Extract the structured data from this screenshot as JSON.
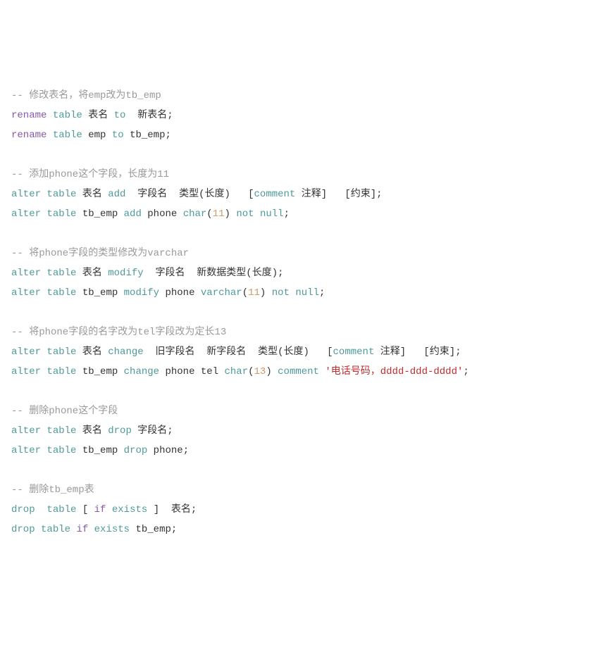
{
  "lines": [
    {
      "type": "comment",
      "text": "-- 修改表名，将emp改为tb_emp"
    },
    {
      "type": "code",
      "tokens": [
        {
          "t": "rename",
          "c": "keyword-purple"
        },
        {
          "t": " ",
          "c": "punct"
        },
        {
          "t": "table",
          "c": "keyword"
        },
        {
          "t": " 表名 ",
          "c": "identifier"
        },
        {
          "t": "to",
          "c": "keyword"
        },
        {
          "t": "  新表名",
          "c": "identifier"
        },
        {
          "t": ";",
          "c": "punct"
        }
      ]
    },
    {
      "type": "code",
      "tokens": [
        {
          "t": "rename",
          "c": "keyword-purple"
        },
        {
          "t": " ",
          "c": "punct"
        },
        {
          "t": "table",
          "c": "keyword"
        },
        {
          "t": " emp ",
          "c": "identifier"
        },
        {
          "t": "to",
          "c": "keyword"
        },
        {
          "t": " tb_emp",
          "c": "identifier"
        },
        {
          "t": ";",
          "c": "punct"
        }
      ]
    },
    {
      "type": "blank"
    },
    {
      "type": "comment",
      "text": "-- 添加phone这个字段，长度为11"
    },
    {
      "type": "code",
      "tokens": [
        {
          "t": "alter",
          "c": "keyword"
        },
        {
          "t": " ",
          "c": "punct"
        },
        {
          "t": "table",
          "c": "keyword"
        },
        {
          "t": " 表名 ",
          "c": "identifier"
        },
        {
          "t": "add",
          "c": "keyword"
        },
        {
          "t": "  字段名  类型",
          "c": "identifier"
        },
        {
          "t": "(",
          "c": "paren"
        },
        {
          "t": "长度",
          "c": "identifier"
        },
        {
          "t": ")",
          "c": "paren"
        },
        {
          "t": "   ",
          "c": "punct"
        },
        {
          "t": "[",
          "c": "bracket"
        },
        {
          "t": "comment",
          "c": "keyword"
        },
        {
          "t": " 注释",
          "c": "identifier"
        },
        {
          "t": "]",
          "c": "bracket"
        },
        {
          "t": "   ",
          "c": "punct"
        },
        {
          "t": "[",
          "c": "bracket"
        },
        {
          "t": "约束",
          "c": "identifier"
        },
        {
          "t": "]",
          "c": "bracket"
        },
        {
          "t": ";",
          "c": "punct"
        }
      ]
    },
    {
      "type": "code",
      "tokens": [
        {
          "t": "alter",
          "c": "keyword"
        },
        {
          "t": " ",
          "c": "punct"
        },
        {
          "t": "table",
          "c": "keyword"
        },
        {
          "t": " tb_emp ",
          "c": "identifier"
        },
        {
          "t": "add",
          "c": "keyword"
        },
        {
          "t": " phone ",
          "c": "identifier"
        },
        {
          "t": "char",
          "c": "keyword"
        },
        {
          "t": "(",
          "c": "paren"
        },
        {
          "t": "11",
          "c": "number"
        },
        {
          "t": ")",
          "c": "paren"
        },
        {
          "t": " ",
          "c": "punct"
        },
        {
          "t": "not",
          "c": "keyword"
        },
        {
          "t": " ",
          "c": "punct"
        },
        {
          "t": "null",
          "c": "keyword"
        },
        {
          "t": ";",
          "c": "punct"
        }
      ]
    },
    {
      "type": "blank"
    },
    {
      "type": "comment",
      "text": "-- 将phone字段的类型修改为varchar"
    },
    {
      "type": "code",
      "tokens": [
        {
          "t": "alter",
          "c": "keyword"
        },
        {
          "t": " ",
          "c": "punct"
        },
        {
          "t": "table",
          "c": "keyword"
        },
        {
          "t": " 表名 ",
          "c": "identifier"
        },
        {
          "t": "modify",
          "c": "keyword"
        },
        {
          "t": "  字段名  新数据类型",
          "c": "identifier"
        },
        {
          "t": "(",
          "c": "paren"
        },
        {
          "t": "长度",
          "c": "identifier"
        },
        {
          "t": ")",
          "c": "paren"
        },
        {
          "t": ";",
          "c": "punct"
        }
      ]
    },
    {
      "type": "code",
      "tokens": [
        {
          "t": "alter",
          "c": "keyword"
        },
        {
          "t": " ",
          "c": "punct"
        },
        {
          "t": "table",
          "c": "keyword"
        },
        {
          "t": " tb_emp ",
          "c": "identifier"
        },
        {
          "t": "modify",
          "c": "keyword"
        },
        {
          "t": " phone ",
          "c": "identifier"
        },
        {
          "t": "varchar",
          "c": "keyword"
        },
        {
          "t": "(",
          "c": "paren"
        },
        {
          "t": "11",
          "c": "number"
        },
        {
          "t": ")",
          "c": "paren"
        },
        {
          "t": " ",
          "c": "punct"
        },
        {
          "t": "not",
          "c": "keyword"
        },
        {
          "t": " ",
          "c": "punct"
        },
        {
          "t": "null",
          "c": "keyword"
        },
        {
          "t": ";",
          "c": "punct"
        }
      ]
    },
    {
      "type": "blank"
    },
    {
      "type": "comment",
      "text": "-- 将phone字段的名字改为tel字段改为定长13"
    },
    {
      "type": "code",
      "tokens": [
        {
          "t": "alter",
          "c": "keyword"
        },
        {
          "t": " ",
          "c": "punct"
        },
        {
          "t": "table",
          "c": "keyword"
        },
        {
          "t": " 表名 ",
          "c": "identifier"
        },
        {
          "t": "change",
          "c": "keyword"
        },
        {
          "t": "  旧字段名  新字段名  类型",
          "c": "identifier"
        },
        {
          "t": "(",
          "c": "paren"
        },
        {
          "t": "长度",
          "c": "identifier"
        },
        {
          "t": ")",
          "c": "paren"
        },
        {
          "t": "   ",
          "c": "punct"
        },
        {
          "t": "[",
          "c": "bracket"
        },
        {
          "t": "comment",
          "c": "keyword"
        },
        {
          "t": " 注释",
          "c": "identifier"
        },
        {
          "t": "]",
          "c": "bracket"
        },
        {
          "t": "   ",
          "c": "punct"
        },
        {
          "t": "[",
          "c": "bracket"
        },
        {
          "t": "约束",
          "c": "identifier"
        },
        {
          "t": "]",
          "c": "bracket"
        },
        {
          "t": ";",
          "c": "punct"
        }
      ]
    },
    {
      "type": "code",
      "tokens": [
        {
          "t": "alter",
          "c": "keyword"
        },
        {
          "t": " ",
          "c": "punct"
        },
        {
          "t": "table",
          "c": "keyword"
        },
        {
          "t": " tb_emp ",
          "c": "identifier"
        },
        {
          "t": "change",
          "c": "keyword"
        },
        {
          "t": " phone tel ",
          "c": "identifier"
        },
        {
          "t": "char",
          "c": "keyword"
        },
        {
          "t": "(",
          "c": "paren"
        },
        {
          "t": "13",
          "c": "number"
        },
        {
          "t": ")",
          "c": "paren"
        },
        {
          "t": " ",
          "c": "punct"
        },
        {
          "t": "comment",
          "c": "keyword"
        },
        {
          "t": " ",
          "c": "punct"
        },
        {
          "t": "'电话号码，dddd-ddd-dddd'",
          "c": "string"
        },
        {
          "t": ";",
          "c": "punct"
        }
      ]
    },
    {
      "type": "blank"
    },
    {
      "type": "comment",
      "text": "-- 删除phone这个字段"
    },
    {
      "type": "code",
      "tokens": [
        {
          "t": "alter",
          "c": "keyword"
        },
        {
          "t": " ",
          "c": "punct"
        },
        {
          "t": "table",
          "c": "keyword"
        },
        {
          "t": " 表名 ",
          "c": "identifier"
        },
        {
          "t": "drop",
          "c": "keyword"
        },
        {
          "t": " 字段名",
          "c": "identifier"
        },
        {
          "t": ";",
          "c": "punct"
        }
      ]
    },
    {
      "type": "code",
      "tokens": [
        {
          "t": "alter",
          "c": "keyword"
        },
        {
          "t": " ",
          "c": "punct"
        },
        {
          "t": "table",
          "c": "keyword"
        },
        {
          "t": " tb_emp ",
          "c": "identifier"
        },
        {
          "t": "drop",
          "c": "keyword"
        },
        {
          "t": " phone",
          "c": "identifier"
        },
        {
          "t": ";",
          "c": "punct"
        }
      ]
    },
    {
      "type": "blank"
    },
    {
      "type": "comment",
      "text": "-- 删除tb_emp表"
    },
    {
      "type": "code",
      "tokens": [
        {
          "t": "drop",
          "c": "keyword"
        },
        {
          "t": "  ",
          "c": "punct"
        },
        {
          "t": "table",
          "c": "keyword"
        },
        {
          "t": " ",
          "c": "punct"
        },
        {
          "t": "[",
          "c": "bracket"
        },
        {
          "t": " ",
          "c": "punct"
        },
        {
          "t": "if",
          "c": "keyword-purple"
        },
        {
          "t": " ",
          "c": "punct"
        },
        {
          "t": "exists",
          "c": "keyword"
        },
        {
          "t": " ",
          "c": "punct"
        },
        {
          "t": "]",
          "c": "bracket"
        },
        {
          "t": "  表名",
          "c": "identifier"
        },
        {
          "t": ";",
          "c": "punct"
        }
      ]
    },
    {
      "type": "code",
      "tokens": [
        {
          "t": "drop",
          "c": "keyword"
        },
        {
          "t": " ",
          "c": "punct"
        },
        {
          "t": "table",
          "c": "keyword"
        },
        {
          "t": " ",
          "c": "punct"
        },
        {
          "t": "if",
          "c": "keyword-purple"
        },
        {
          "t": " ",
          "c": "punct"
        },
        {
          "t": "exists",
          "c": "keyword"
        },
        {
          "t": " tb_emp",
          "c": "identifier"
        },
        {
          "t": ";",
          "c": "punct"
        }
      ]
    }
  ]
}
